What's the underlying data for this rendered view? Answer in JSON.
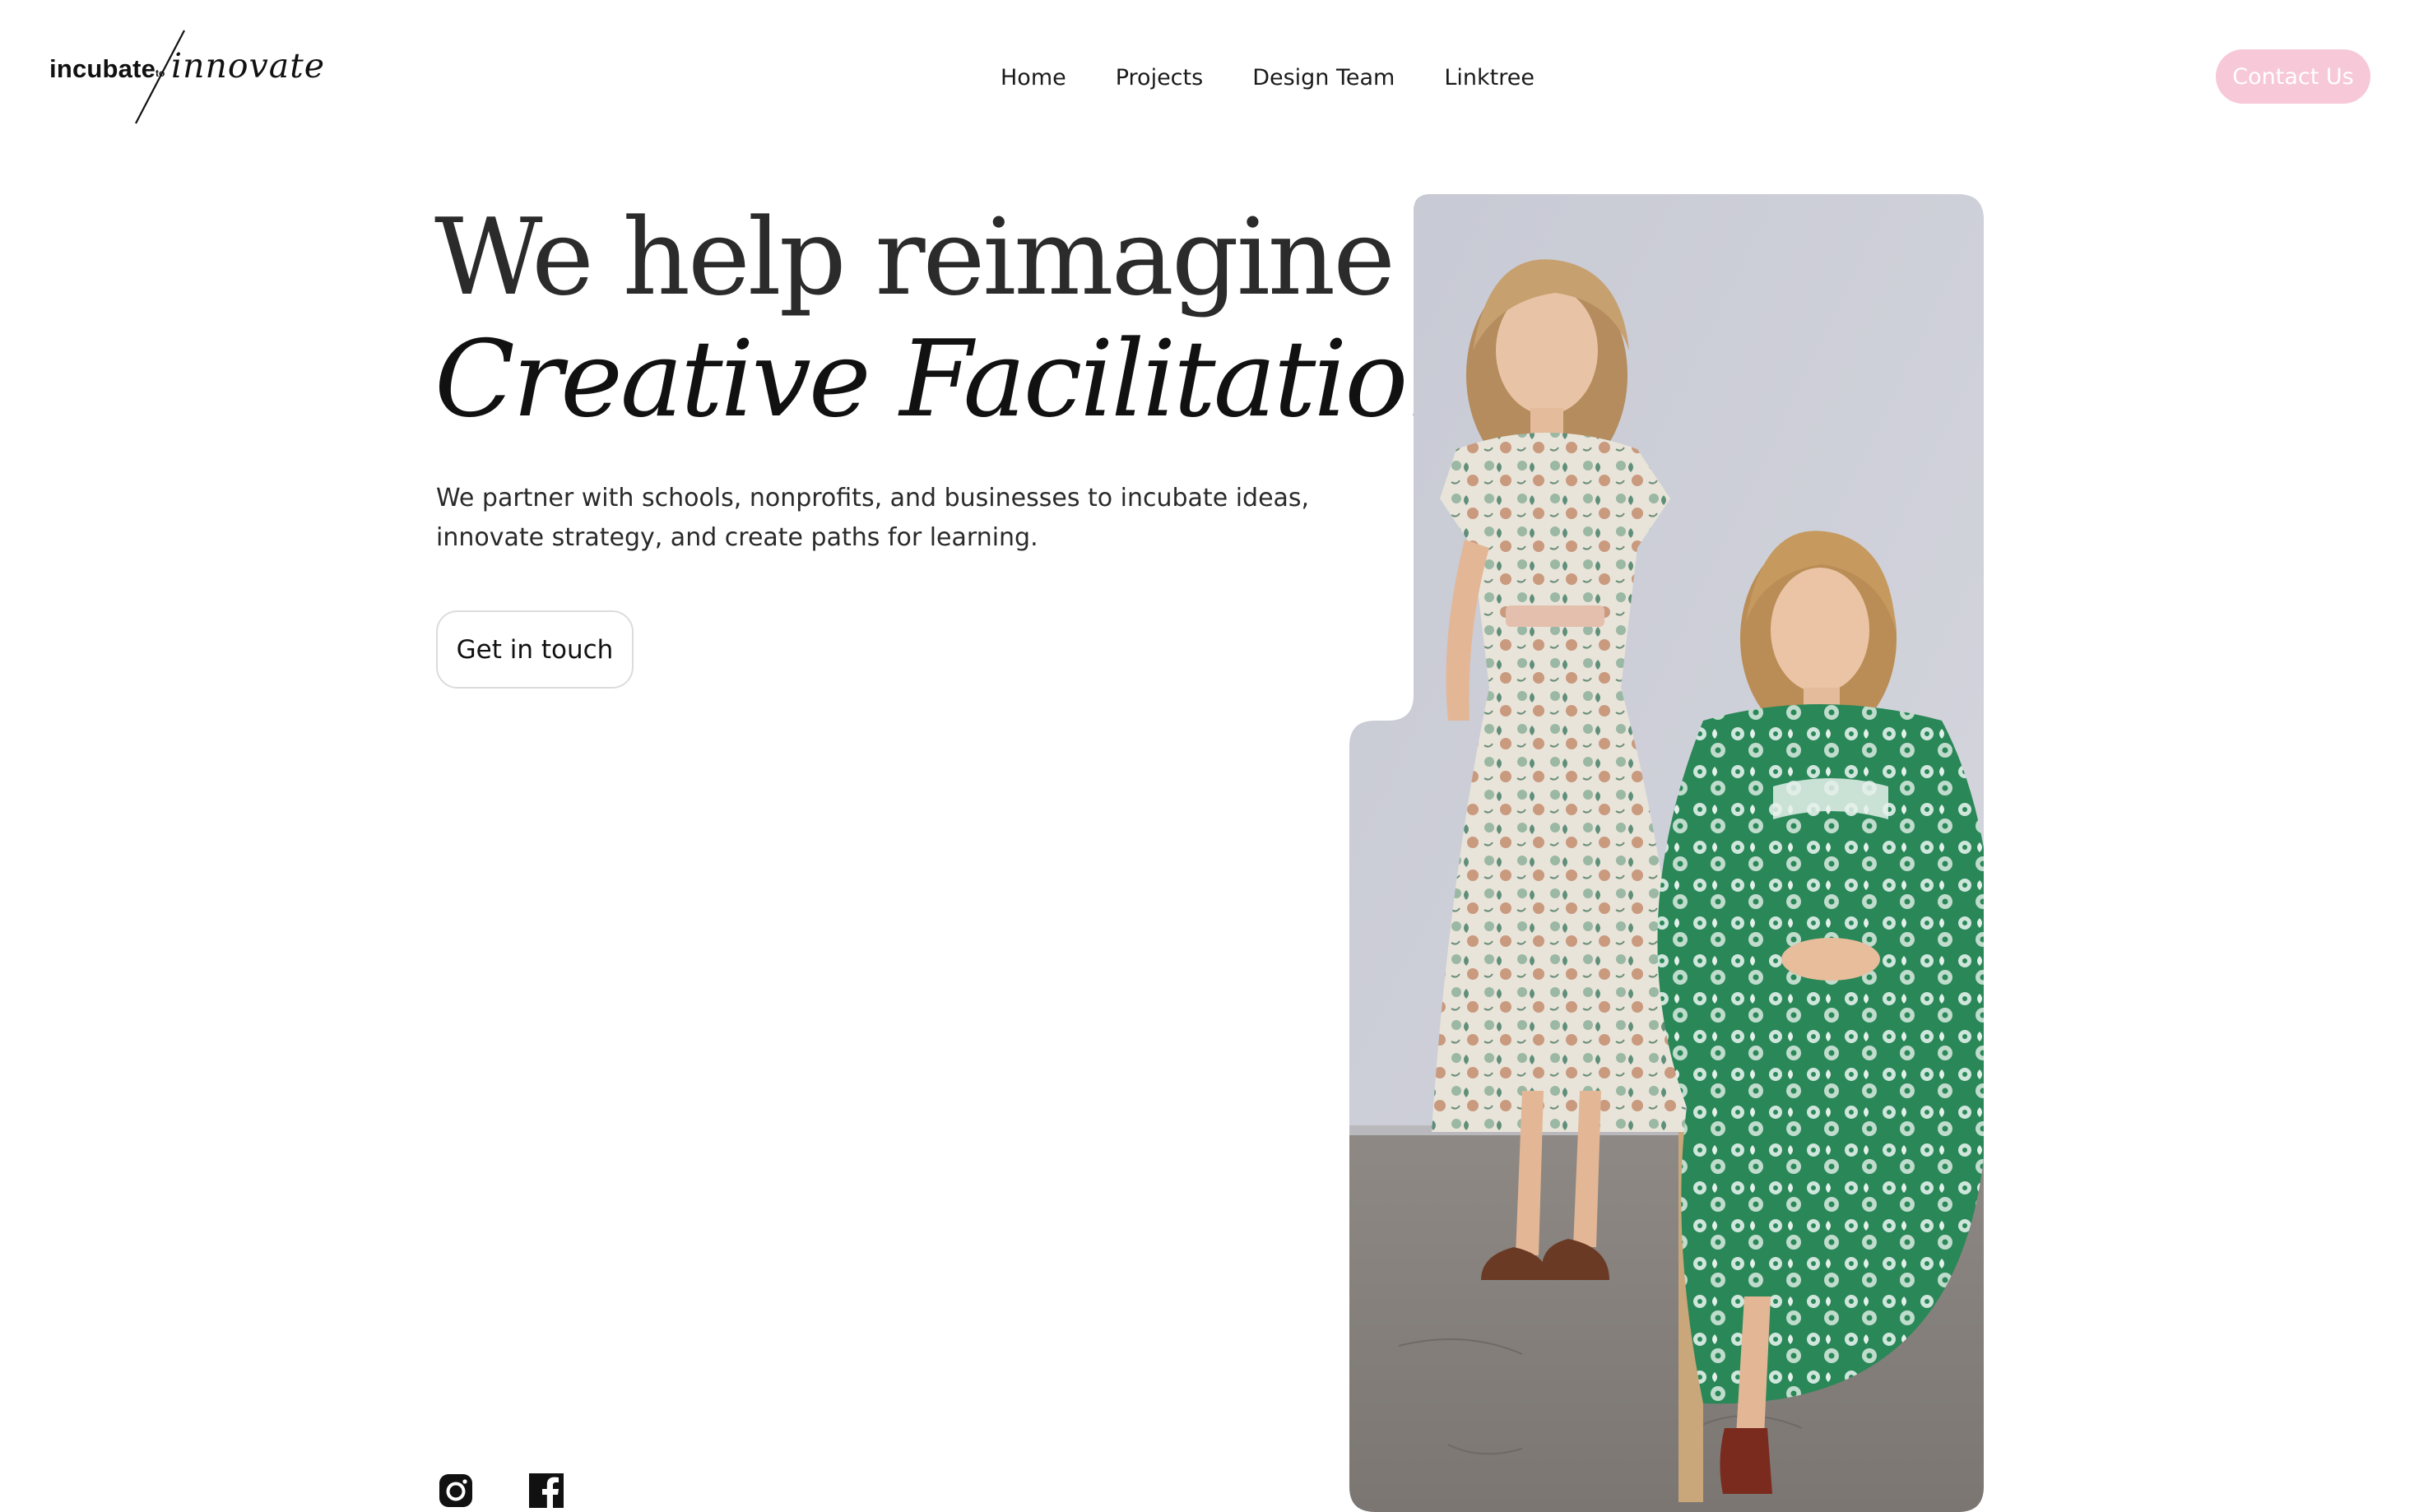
{
  "header": {
    "logo": {
      "word_one": "incubate",
      "connector": "to",
      "word_two": "innovate"
    },
    "nav": [
      {
        "label": "Home"
      },
      {
        "label": "Projects"
      },
      {
        "label": "Design Team"
      },
      {
        "label": "Linktree"
      }
    ],
    "contact_label": "Contact Us"
  },
  "hero": {
    "headline_line1": "We help reimagine",
    "headline_line2": "Creative Facilitation",
    "lead_line1": "We partner with schools, nonprofits, and businesses to incubate ideas,",
    "lead_line2": "innovate strategy, and create paths for learning.",
    "cta_label": "Get in touch"
  },
  "social": {
    "icons": [
      "instagram-icon",
      "facebook-icon"
    ]
  },
  "colors": {
    "accent_pink": "#f7c8d8",
    "text": "#2b2b2b",
    "dress_green": "#2f8f5f",
    "backdrop": "#c9ccd6"
  }
}
